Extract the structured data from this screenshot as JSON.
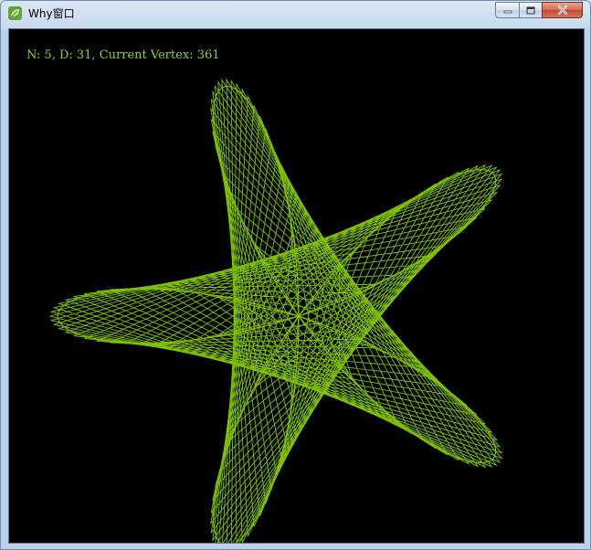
{
  "window": {
    "title": "Why窗口",
    "icon": "leaf-app-icon",
    "controls": [
      "minimize-icon",
      "maximize-icon",
      "close-icon"
    ]
  },
  "canvas": {
    "background": "#000000",
    "line_color": "#7fc000",
    "status_text": "N: 5, D: 31, Current Vertex: 361",
    "status_color": "#8fd41c",
    "n": 5,
    "d": 31,
    "current_vertex": 361
  }
}
